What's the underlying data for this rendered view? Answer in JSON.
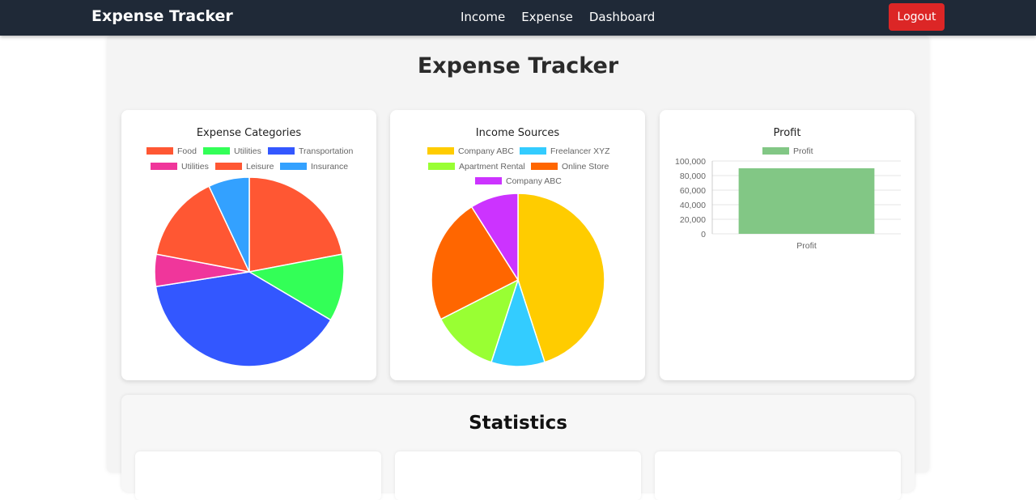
{
  "navbar": {
    "brand": "Expense Tracker",
    "links": [
      "Income",
      "Expense",
      "Dashboard"
    ],
    "logout_label": "Logout",
    "logout_color": "#dc2626",
    "background": "#1f2937"
  },
  "page": {
    "title": "Expense Tracker"
  },
  "chart_data": [
    {
      "type": "pie",
      "title": "Expense Categories",
      "legend_position": "top",
      "labels": [
        "Food",
        "Utilities",
        "Transportation",
        "Utilities",
        "Leisure",
        "Insurance"
      ],
      "values": [
        22,
        11.5,
        39,
        5.5,
        15,
        7
      ],
      "colors": [
        "#ff5733",
        "#33ff57",
        "#3357ff",
        "#f0369b",
        "#ff5733",
        "#33a1ff"
      ]
    },
    {
      "type": "pie",
      "title": "Income Sources",
      "legend_position": "top",
      "labels": [
        "Company ABC",
        "Freelancer XYZ",
        "Apartment Rental",
        "Online Store",
        "Company ABC"
      ],
      "values": [
        45,
        10,
        12.5,
        23.5,
        9
      ],
      "colors": [
        "#ffcc00",
        "#33ccff",
        "#99ff33",
        "#ff6600",
        "#cc33ff"
      ]
    },
    {
      "type": "bar",
      "title": "Profit",
      "legend_position": "top",
      "categories": [
        "Profit"
      ],
      "series": [
        {
          "name": "Profit",
          "values": [
            90000
          ]
        }
      ],
      "colors": [
        "#82c785"
      ],
      "ylim": [
        0,
        100000
      ],
      "yticks": [
        "100,000",
        "80,000",
        "60,000",
        "40,000",
        "20,000",
        "0"
      ],
      "grid": true
    }
  ],
  "statistics": {
    "title": "Statistics"
  }
}
